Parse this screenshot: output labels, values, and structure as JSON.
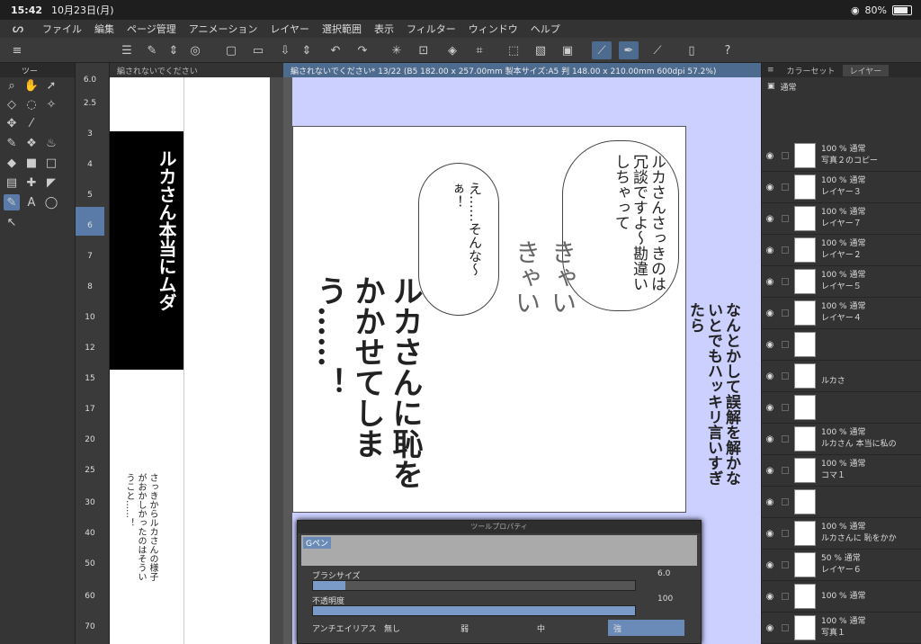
{
  "status": {
    "time": "15:42",
    "date": "10月23日(月)",
    "battery": "80%"
  },
  "menu": [
    "ファイル",
    "編集",
    "ページ管理",
    "アニメーション",
    "レイヤー",
    "選択範囲",
    "表示",
    "フィルター",
    "ウィンドウ",
    "ヘルプ"
  ],
  "left_panel": {
    "tab": "ツー"
  },
  "brush_sizes": [
    "6.0",
    "2.5",
    "3",
    "4",
    "5",
    "6",
    "7",
    "8",
    "10",
    "12",
    "15",
    "17",
    "20",
    "25",
    "30",
    "40",
    "50",
    "60",
    "70"
  ],
  "nav_doc": {
    "tab": "編されないでください"
  },
  "canvas_doc": {
    "tab": "編されないでください* 13/22 (B5 182.00 x 257.00mm 製本サイズ:A5 判 148.00 x 210.00mm 600dpi 57.2%)"
  },
  "manga": {
    "bubble1": "ルカさんさっきのは冗談ですよ〜勘違いしちゃって",
    "bubble2": "え……そんな〜ぁ！",
    "big": "ルカさんに恥をかかせてしまう……！",
    "side": "なんとかして誤解を解かないとでもハッキリ言いすぎたら",
    "sfx": "きゃいきゃい",
    "nav_text": "ルカさん本当にムダ",
    "nav_small": "さっきからルカさんの様子がおかしかったのはそういうこと……！"
  },
  "right_panel": {
    "tabs": [
      "カラーセット",
      "レイヤー"
    ],
    "blend": "通常",
    "layers": [
      {
        "opacity": "100 %",
        "mode": "通常",
        "name": "写真２のコピー"
      },
      {
        "opacity": "100 %",
        "mode": "通常",
        "name": "レイヤー３"
      },
      {
        "opacity": "100 %",
        "mode": "通常",
        "name": "レイヤー７"
      },
      {
        "opacity": "100 %",
        "mode": "通常",
        "name": "レイヤー２"
      },
      {
        "opacity": "100 %",
        "mode": "通常",
        "name": "レイヤー５"
      },
      {
        "opacity": "100 %",
        "mode": "通常",
        "name": "レイヤー４"
      },
      {
        "opacity": "",
        "mode": "",
        "name": ""
      },
      {
        "opacity": "",
        "mode": "",
        "name": "ルカさ"
      },
      {
        "opacity": "",
        "mode": "",
        "name": ""
      },
      {
        "opacity": "100 %",
        "mode": "通常",
        "name": "ルカさん 本当に私の"
      },
      {
        "opacity": "100 %",
        "mode": "通常",
        "name": "コマ１"
      },
      {
        "opacity": "",
        "mode": "",
        "name": ""
      },
      {
        "opacity": "100 %",
        "mode": "通常",
        "name": "ルカさんに 恥をかか"
      },
      {
        "opacity": "50 %",
        "mode": "通常",
        "name": "レイヤー６"
      },
      {
        "opacity": "100 %",
        "mode": "通常",
        "name": ""
      },
      {
        "opacity": "100 %",
        "mode": "通常",
        "name": "写真１"
      }
    ]
  },
  "tool_props": {
    "title": "ツールプロパティ",
    "brush": "Gペン",
    "size_label": "ブラシサイズ",
    "size_value": "6.0",
    "opacity_label": "不透明度",
    "opacity_value": "100",
    "aa_label": "アンチエイリアス",
    "aa_options": [
      "無し",
      "弱",
      "中",
      "強"
    ]
  }
}
